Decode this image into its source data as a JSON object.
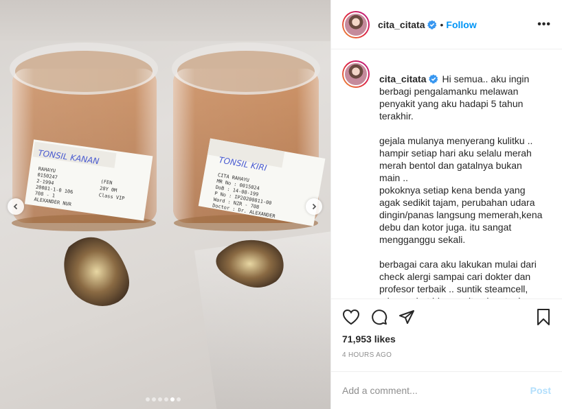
{
  "post": {
    "username": "cita_citata",
    "follow_label": "Follow",
    "separator": "•",
    "more_label": "•••",
    "caption": {
      "username": "cita_citata",
      "paragraphs": [
        "Hi semua.. aku ingin berbagi pengalamanku melawan penyakit yang aku hadapi 5 tahun terakhir.",
        "gejala mulanya menyerang kulitku .. hampir setiap hari aku selalu merah merah bentol dan gatalnya bukan main ..\npokoknya setiap kena benda yang agak sedikit tajam, perubahan udara dingin/panas langsung memerah,kena debu dan kotor juga. itu sangat mengganggu sekali.",
        "berbagai cara aku lakukan mulai dari check alergi sampai cari dokter dan profesor terbaik .. suntik steamcell, minum obat hingga vitamin .. tapi ngga pernah ada hasil .. selalu"
      ]
    },
    "likes": "71,953 likes",
    "time": "4 HOURS AGO",
    "comment_placeholder": "Add a comment...",
    "post_label": "Post"
  },
  "photo": {
    "jar_left": {
      "handwritten": "TONSIL KANAN",
      "label_lines": [
        "RAHAYU",
        "0150247",
        "2-1994",
        "20081-1-0 106",
        "708 - 1",
        "ALEXANDER NUR"
      ],
      "label_side": [
        "(FEN",
        "28Y 0M",
        "Class VIP"
      ]
    },
    "jar_right": {
      "handwritten": "TONSIL KIRI",
      "label_lines": [
        "CITA RAHAYU",
        "MR No : 0015024",
        "DoB : 14-08-199",
        "P No : IP20200811-00",
        "Ward : NZR - 708",
        "Doctor : Dr. ALEXANDER"
      ],
      "label_keys": [
        "MR No",
        "DoB",
        "P No",
        "Ward",
        "Doctor"
      ]
    },
    "slides_total": 6,
    "slide_active": 5
  },
  "colors": {
    "accent": "#0095f6",
    "post_disabled": "#b2dffc",
    "muted": "#8e8e8e",
    "verified": "#3897f0"
  },
  "icons": {
    "header_more": "more-horizontal-icon",
    "like": "heart-outline-icon",
    "comment": "speech-bubble-icon",
    "share": "paper-plane-icon",
    "save": "bookmark-icon",
    "prev": "chevron-left-icon",
    "next": "chevron-right-icon"
  }
}
